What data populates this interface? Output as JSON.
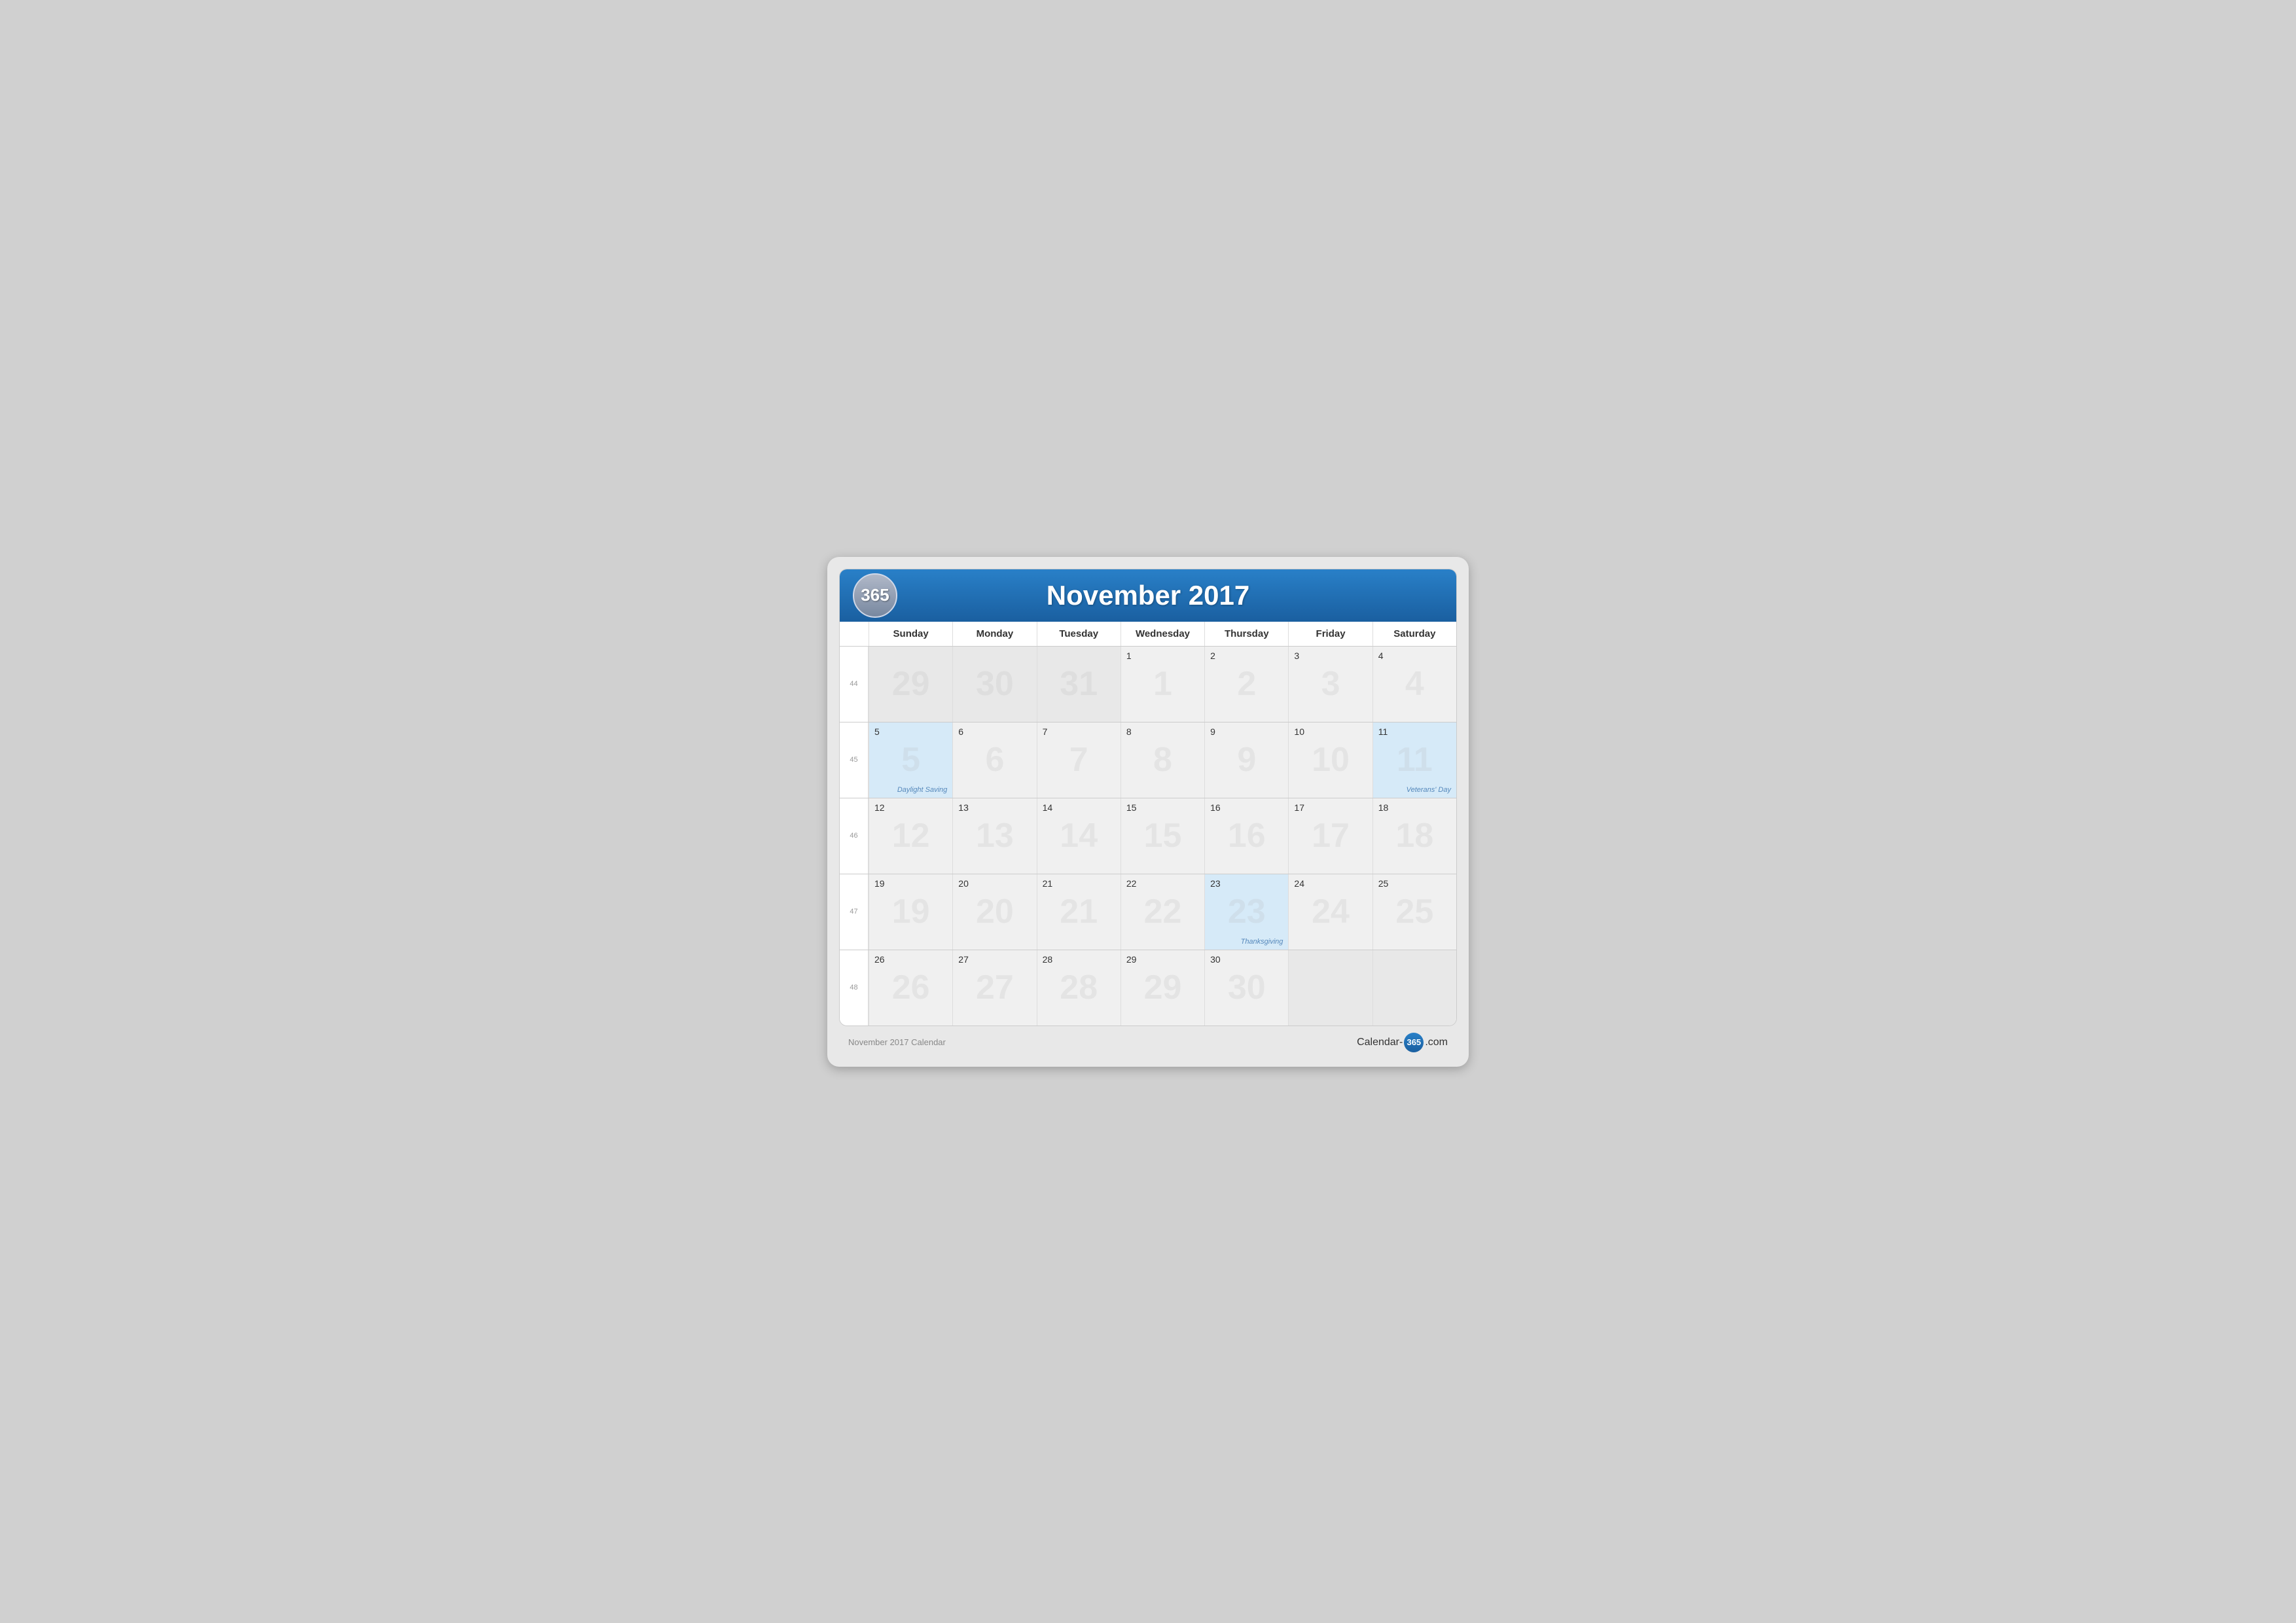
{
  "header": {
    "logo": "365",
    "title": "November 2017"
  },
  "dayHeaders": [
    "Sunday",
    "Monday",
    "Tuesday",
    "Wednesday",
    "Thursday",
    "Friday",
    "Saturday"
  ],
  "weeks": [
    {
      "weekNum": "44",
      "days": [
        {
          "date": "",
          "prev": true,
          "watermark": "29"
        },
        {
          "date": "",
          "prev": true,
          "watermark": "30"
        },
        {
          "date": "",
          "prev": true,
          "watermark": "31"
        },
        {
          "date": "1",
          "watermark": "1"
        },
        {
          "date": "2",
          "watermark": "2"
        },
        {
          "date": "3",
          "watermark": "3"
        },
        {
          "date": "4",
          "watermark": "4"
        }
      ]
    },
    {
      "weekNum": "45",
      "days": [
        {
          "date": "5",
          "highlight": true,
          "event": "Daylight Saving",
          "watermark": "5"
        },
        {
          "date": "6",
          "watermark": "6"
        },
        {
          "date": "7",
          "watermark": "7"
        },
        {
          "date": "8",
          "watermark": "8"
        },
        {
          "date": "9",
          "watermark": "9"
        },
        {
          "date": "10",
          "watermark": "10"
        },
        {
          "date": "11",
          "highlight": true,
          "event": "Veterans' Day",
          "watermark": "11"
        }
      ]
    },
    {
      "weekNum": "46",
      "days": [
        {
          "date": "12",
          "watermark": "12"
        },
        {
          "date": "13",
          "watermark": "13"
        },
        {
          "date": "14",
          "watermark": "14"
        },
        {
          "date": "15",
          "watermark": "15"
        },
        {
          "date": "16",
          "watermark": "16"
        },
        {
          "date": "17",
          "watermark": "17"
        },
        {
          "date": "18",
          "watermark": "18"
        }
      ]
    },
    {
      "weekNum": "47",
      "days": [
        {
          "date": "19",
          "watermark": "19"
        },
        {
          "date": "20",
          "watermark": "20"
        },
        {
          "date": "21",
          "watermark": "21"
        },
        {
          "date": "22",
          "watermark": "22"
        },
        {
          "date": "23",
          "highlight": true,
          "event": "Thanksgiving",
          "watermark": "23"
        },
        {
          "date": "24",
          "watermark": "24"
        },
        {
          "date": "25",
          "watermark": "25"
        }
      ]
    },
    {
      "weekNum": "48",
      "days": [
        {
          "date": "26",
          "watermark": "26"
        },
        {
          "date": "27",
          "watermark": "27"
        },
        {
          "date": "28",
          "watermark": "28"
        },
        {
          "date": "29",
          "watermark": "29"
        },
        {
          "date": "30",
          "watermark": "30"
        },
        {
          "date": "",
          "prev": true,
          "watermark": ""
        },
        {
          "date": "",
          "prev": true,
          "watermark": ""
        }
      ]
    }
  ],
  "footer": {
    "left": "November 2017 Calendar",
    "right_prefix": "Calendar-",
    "right_logo": "365",
    "right_suffix": ".com"
  }
}
